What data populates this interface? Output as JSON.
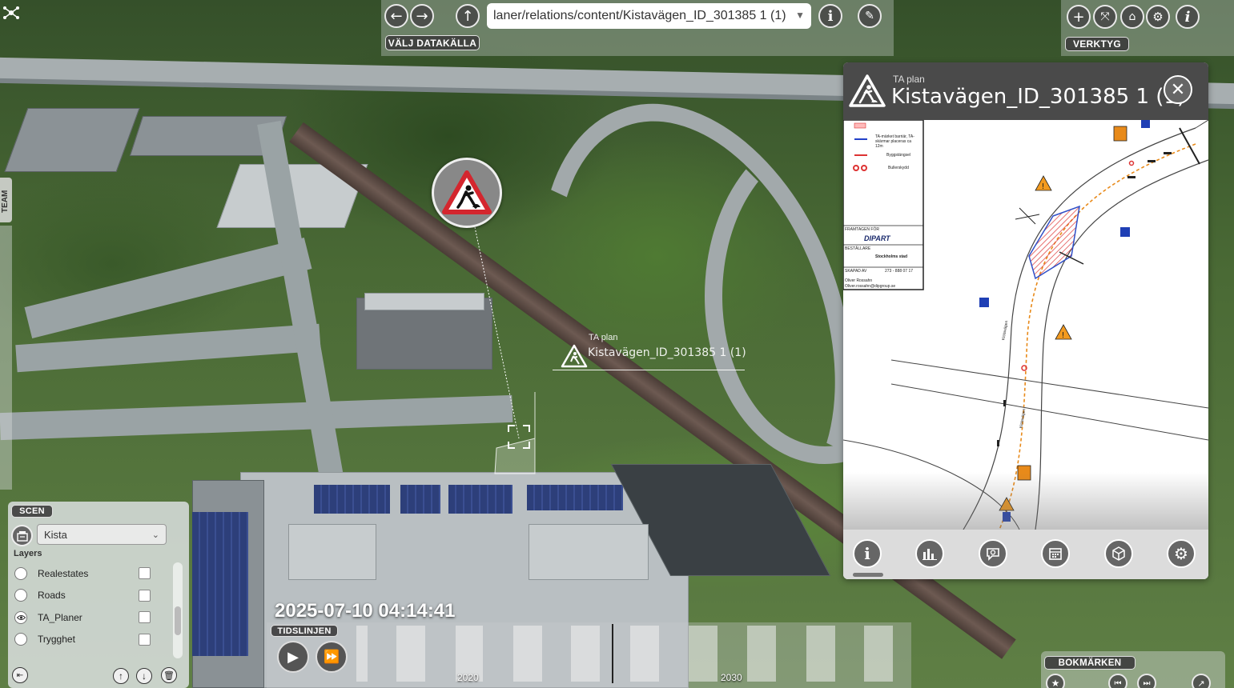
{
  "topbar": {
    "url_value": "laner/relations/content/Kistavägen_ID_301385 1 (1)",
    "data_source_label": "VÄLJ DATAKÄLLA"
  },
  "tools": {
    "label": "VERKTYG"
  },
  "team_tab": {
    "label": "TEAM"
  },
  "map_label": {
    "subtitle": "TA plan",
    "title": "Kistavägen_ID_301385 1 (1)"
  },
  "panel": {
    "subtitle": "TA plan",
    "title": "Kistavägen_ID_301385 1 (1)",
    "drawing_texts": {
      "legend_barrier": "TA-märket barriär, TA-skärmar placeras ca 12m",
      "legend_bygg": "Byggstängsel",
      "legend_bul": "Bullerskydd",
      "framtagen": "FRAMTAGEN FÖR",
      "company": "DIPART",
      "bestallare": "BESTÄLLARE",
      "city": "Stockholms stad",
      "skapad": "SKAPAD AV",
      "ref": "273 - 888 07 17",
      "author": "Oliver Rossahn",
      "email": "Oliver.rossahn@dipgroup.se",
      "road_1": "Kistavägen",
      "road_2": "Kistavägen"
    },
    "footer_icons": [
      "info-icon",
      "bar-chart-icon",
      "comment-icon",
      "calendar-icon",
      "cube-icon",
      "gear-icon"
    ]
  },
  "scene": {
    "label": "SCEN",
    "selected": "Kista",
    "layers_label": "Layers",
    "layers": [
      {
        "name": "Realestates",
        "visible": false,
        "checked": false
      },
      {
        "name": "Roads",
        "visible": false,
        "checked": false
      },
      {
        "name": "TA_Planer",
        "visible": true,
        "checked": false
      },
      {
        "name": "Trygghet",
        "visible": false,
        "checked": false
      }
    ]
  },
  "timeline": {
    "timestamp": "2025-07-10 04:14:41",
    "label": "TIDSLINJEN",
    "years": [
      "2020",
      "2030"
    ]
  },
  "bookmarks": {
    "label": "BOKMÄRKEN"
  },
  "colors": {
    "panel_header": "#4a4a4a",
    "warning_red": "#d4262e",
    "warning_orange": "#f29a1f",
    "sign_blue": "#1f3fb5"
  }
}
